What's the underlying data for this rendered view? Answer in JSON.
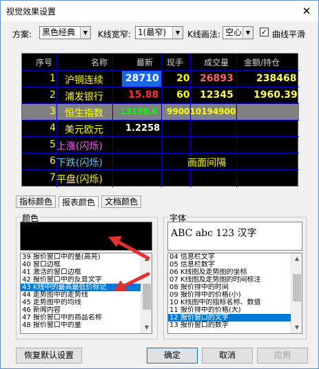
{
  "window": {
    "title": "视觉效果设置",
    "close_glyph": "✕"
  },
  "toolbar": {
    "scheme_label": "方案:",
    "scheme_value": "黑色经典",
    "kline_width_label": "K线宽窄:",
    "kline_width_value": "1(最窄)",
    "kline_draw_label": "K线画法:",
    "kline_draw_value": "空心",
    "smooth_label": "曲线平滑",
    "smooth_checked": "✓"
  },
  "preview": {
    "headers": [
      "序号",
      "名称",
      "最新",
      "现手",
      "成交量",
      "金额/持仓"
    ],
    "rows": [
      {
        "idx": "1",
        "name": "沪铜连续",
        "last": "28710",
        "hand": "20",
        "volume": "26893",
        "amount": "238468"
      },
      {
        "idx": "2",
        "name": "浦发银行",
        "last": "15.88",
        "hand": "60",
        "volume": "12345",
        "amount": "1960.39"
      },
      {
        "idx": "3",
        "name": "恒生指数",
        "last": "13138.6",
        "hand": "990010194900",
        "volume": "",
        "amount": ""
      },
      {
        "idx": "4",
        "name": "美元欧元",
        "last": "1.2258",
        "hand": "",
        "volume": "",
        "amount": ""
      },
      {
        "idx": "5",
        "name": "上涨(闪烁)",
        "last": "",
        "hand": "",
        "volume": "",
        "amount": ""
      },
      {
        "idx": "6",
        "name": "下跌(闪烁)",
        "last": "",
        "hand": "",
        "volume": "画面间隔",
        "amount": ""
      },
      {
        "idx": "7",
        "name": "平盘(闪烁)",
        "last": "",
        "hand": "",
        "volume": "",
        "amount": ""
      }
    ]
  },
  "tabs": [
    "指标颜色",
    "报表颜色",
    "文档颜色"
  ],
  "color_group": {
    "title": "颜色",
    "items": [
      "39 报价窗口中的量(高亮)",
      "40 窗口边框",
      "41 激活的窗口边框",
      "42 报价窗口中的反显文字",
      "43 K线中的最高最低价标记",
      "44 走势图中的走势线",
      "45 走势图中的均线",
      "46 新闻内容",
      "47 报价窗口中的商品名称",
      "48 报价窗口中的量"
    ],
    "selected_index": 4
  },
  "font_group": {
    "title": "字体",
    "preview_text": "ABC abc 123 汉字",
    "items": [
      "04 信息栏文字",
      "05 信息栏数字",
      "06 K线图及走势图的坐标",
      "07 K线图及走势图的时间标注",
      "08 报价排中的时间",
      "09 报价排中的价格(小)",
      "10 K线图中的指标名称、数值",
      "11 报价排中的价格(大)",
      "12 报价窗口的文字",
      "13 报价窗口的数字"
    ],
    "selected_index": 8
  },
  "buttons": {
    "restore": "恢复默认设置",
    "ok": "确定",
    "cancel": "取消",
    "apply": "应用"
  },
  "colors": {
    "accent": "#0078d7",
    "preview_bg": "#000000",
    "grid": "#0000c8",
    "annotation_arrow": "#e03030"
  }
}
